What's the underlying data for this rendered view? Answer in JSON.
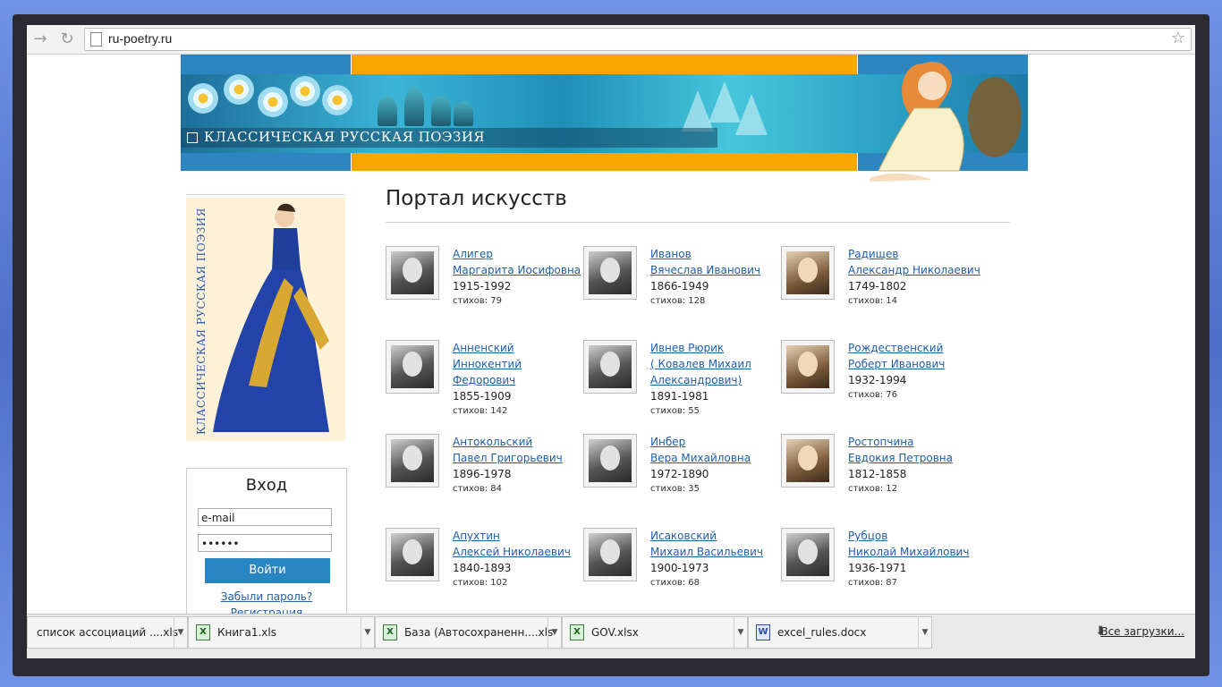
{
  "browser": {
    "back_icon": "arrow-right-icon",
    "reload_icon": "reload-icon",
    "url": "ru-poetry.ru",
    "bookmark_icon": "star-icon"
  },
  "site": {
    "banner_title": "КЛАССИЧЕСКАЯ РУССКАЯ ПОЭЗИЯ",
    "sidebar_title": "КЛАССИЧЕСКАЯ РУССКАЯ ПОЭЗИЯ",
    "colors": {
      "blue": "#2e86c1",
      "orange": "#f7a700",
      "link": "#1f5fa8"
    }
  },
  "login": {
    "title": "Вход",
    "email_value": "e-mail",
    "password_value": "••••••",
    "submit_label": "Войти",
    "forgot_label": "Забыли пароль?",
    "register_label": "Регистрация"
  },
  "portal": {
    "title": "Портал искусств",
    "poets": [
      {
        "lines": [
          "Алигер",
          "Маргарита Иосифовна"
        ],
        "years": "1915-1992",
        "count": "стихов: 79"
      },
      {
        "lines": [
          "Иванов",
          "Вячеслав Иванович"
        ],
        "years": "1866-1949",
        "count": "стихов: 128"
      },
      {
        "lines": [
          "Радищев",
          "Александр Николаевич"
        ],
        "years": "1749-1802",
        "count": "стихов: 14"
      },
      {
        "lines": [
          "Анненский",
          "Иннокентий",
          "Федорович"
        ],
        "years": "1855-1909",
        "count": "стихов: 142"
      },
      {
        "lines": [
          "Ивнев Рюрик",
          "( Ковалев Михаил",
          "Александрович)"
        ],
        "years": "1891-1981",
        "count": "стихов: 55"
      },
      {
        "lines": [
          "Рождественский",
          "Роберт Иванович"
        ],
        "years": "1932-1994",
        "count": "стихов: 76"
      },
      {
        "lines": [
          "Антокольский",
          "Павел Григорьевич"
        ],
        "years": "1896-1978",
        "count": "стихов: 84"
      },
      {
        "lines": [
          "Инбер",
          "Вера Михайловна"
        ],
        "years": "1972-1890",
        "count": "стихов: 35"
      },
      {
        "lines": [
          "Ростопчина",
          "Евдокия Петровна"
        ],
        "years": "1812-1858",
        "count": "стихов: 12"
      },
      {
        "lines": [
          "Апухтин",
          "Алексей Николаевич"
        ],
        "years": "1840-1893",
        "count": "стихов: 102"
      },
      {
        "lines": [
          "Исаковский",
          "Михаил Васильевич"
        ],
        "years": "1900-1973",
        "count": "стихов: 68"
      },
      {
        "lines": [
          "Рубцов",
          "Николай Михайлович"
        ],
        "years": "1936-1971",
        "count": "стихов: 87"
      }
    ]
  },
  "downloads": {
    "items": [
      {
        "name": "список ассоциаций ....xls",
        "icon": "none"
      },
      {
        "name": "Книга1.xls",
        "icon": "excel-icon"
      },
      {
        "name": "База (Автосохраненн....xls",
        "icon": "excel-icon"
      },
      {
        "name": "GOV.xlsx",
        "icon": "excel-icon"
      },
      {
        "name": "excel_rules.docx",
        "icon": "word-icon"
      }
    ],
    "all_label": "Все загрузки..."
  }
}
